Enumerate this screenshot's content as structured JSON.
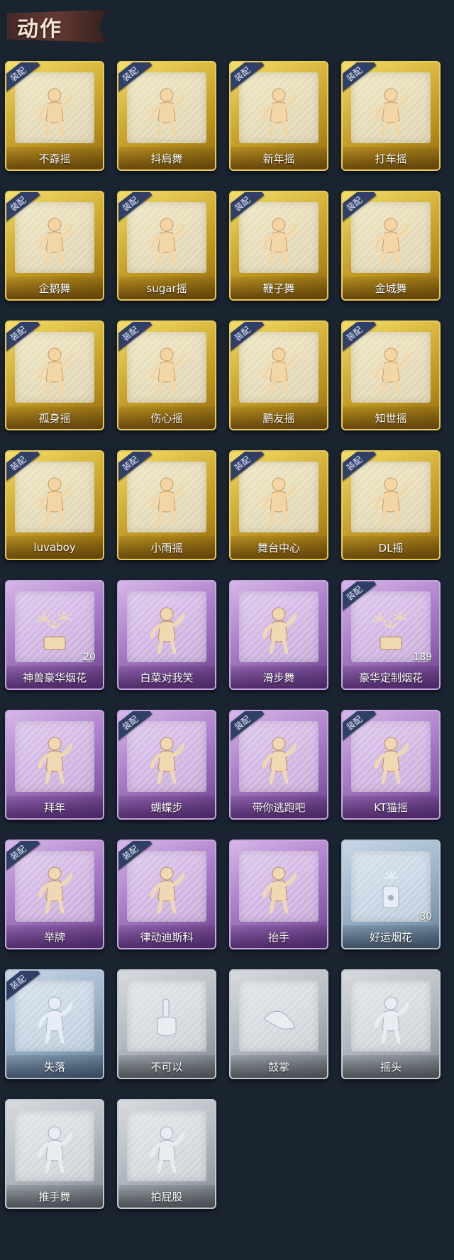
{
  "section_title": "动作",
  "badge_text": "装配",
  "colors": {
    "gold": "#d5b43a",
    "purple": "#b083cc",
    "blue": "#9fb6cd",
    "grey": "#b7bdc4",
    "badge": "#2f3f66",
    "background": "#1a2431"
  },
  "actions": [
    {
      "label": "不孬摇",
      "rarity": "gold",
      "equipped": true,
      "icon": "dancing-figure-icon"
    },
    {
      "label": "抖肩舞",
      "rarity": "gold",
      "equipped": true,
      "icon": "dancing-figure-icon"
    },
    {
      "label": "新年摇",
      "rarity": "gold",
      "equipped": true,
      "icon": "dancing-figure-icon"
    },
    {
      "label": "打车摇",
      "rarity": "gold",
      "equipped": true,
      "icon": "dancing-figure-icon"
    },
    {
      "label": "企鹅舞",
      "rarity": "gold",
      "equipped": true,
      "icon": "dancing-figure-icon"
    },
    {
      "label": "sugar摇",
      "rarity": "gold",
      "equipped": true,
      "icon": "dancing-figure-icon"
    },
    {
      "label": "鞭子舞",
      "rarity": "gold",
      "equipped": true,
      "icon": "dancing-figure-icon"
    },
    {
      "label": "金城舞",
      "rarity": "gold",
      "equipped": true,
      "icon": "dancing-figure-icon"
    },
    {
      "label": "孤身摇",
      "rarity": "gold",
      "equipped": true,
      "icon": "dancing-figure-icon"
    },
    {
      "label": "伤心摇",
      "rarity": "gold",
      "equipped": true,
      "icon": "heart-hands-figure-icon"
    },
    {
      "label": "鹏友摇",
      "rarity": "gold",
      "equipped": true,
      "icon": "dancing-figure-icon"
    },
    {
      "label": "知世摇",
      "rarity": "gold",
      "equipped": true,
      "icon": "dancing-figure-icon"
    },
    {
      "label": "luvaboy",
      "rarity": "gold",
      "equipped": true,
      "icon": "dancing-figure-icon"
    },
    {
      "label": "小雨摇",
      "rarity": "gold",
      "equipped": true,
      "icon": "dancing-figure-icon"
    },
    {
      "label": "舞台中心",
      "rarity": "gold",
      "equipped": true,
      "icon": "dancing-figure-icon"
    },
    {
      "label": "DL摇",
      "rarity": "gold",
      "equipped": true,
      "icon": "dancing-figure-icon"
    },
    {
      "label": "神兽豪华烟花",
      "rarity": "purple",
      "equipped": false,
      "icon": "fireworks-icon",
      "count": "20"
    },
    {
      "label": "白菜对我笑",
      "rarity": "purple",
      "equipped": false,
      "icon": "dancing-figure-icon"
    },
    {
      "label": "滑步舞",
      "rarity": "purple",
      "equipped": false,
      "icon": "dancing-figure-icon"
    },
    {
      "label": "豪华定制烟花",
      "rarity": "purple",
      "equipped": true,
      "icon": "fireworks-icon",
      "count": "189"
    },
    {
      "label": "拜年",
      "rarity": "purple",
      "equipped": false,
      "icon": "bowing-figure-icon"
    },
    {
      "label": "蝴蝶步",
      "rarity": "purple",
      "equipped": true,
      "icon": "dancing-figure-icon"
    },
    {
      "label": "带你逃跑吧",
      "rarity": "purple",
      "equipped": true,
      "icon": "dancing-figure-icon"
    },
    {
      "label": "KT猫摇",
      "rarity": "purple",
      "equipped": true,
      "icon": "dancing-figure-icon"
    },
    {
      "label": "举牌",
      "rarity": "purple",
      "equipped": true,
      "icon": "sign-holding-figure-icon"
    },
    {
      "label": "律动迪斯科",
      "rarity": "purple",
      "equipped": true,
      "icon": "dancing-figure-icon"
    },
    {
      "label": "抬手",
      "rarity": "purple",
      "equipped": false,
      "icon": "raising-hand-figure-icon"
    },
    {
      "label": "好运烟花",
      "rarity": "blue",
      "equipped": false,
      "icon": "firework-can-icon",
      "count": "80"
    },
    {
      "label": "失落",
      "rarity": "blue",
      "equipped": true,
      "icon": "kneeling-figure-icon"
    },
    {
      "label": "不可以",
      "rarity": "grey",
      "equipped": false,
      "icon": "finger-wag-icon"
    },
    {
      "label": "鼓掌",
      "rarity": "grey",
      "equipped": false,
      "icon": "clapping-hands-icon"
    },
    {
      "label": "摇头",
      "rarity": "grey",
      "equipped": false,
      "icon": "head-shake-figure-icon"
    },
    {
      "label": "推手舞",
      "rarity": "grey",
      "equipped": false,
      "icon": "push-hands-figure-icon"
    },
    {
      "label": "拍屁股",
      "rarity": "grey",
      "equipped": false,
      "icon": "spanking-figure-icon"
    }
  ]
}
